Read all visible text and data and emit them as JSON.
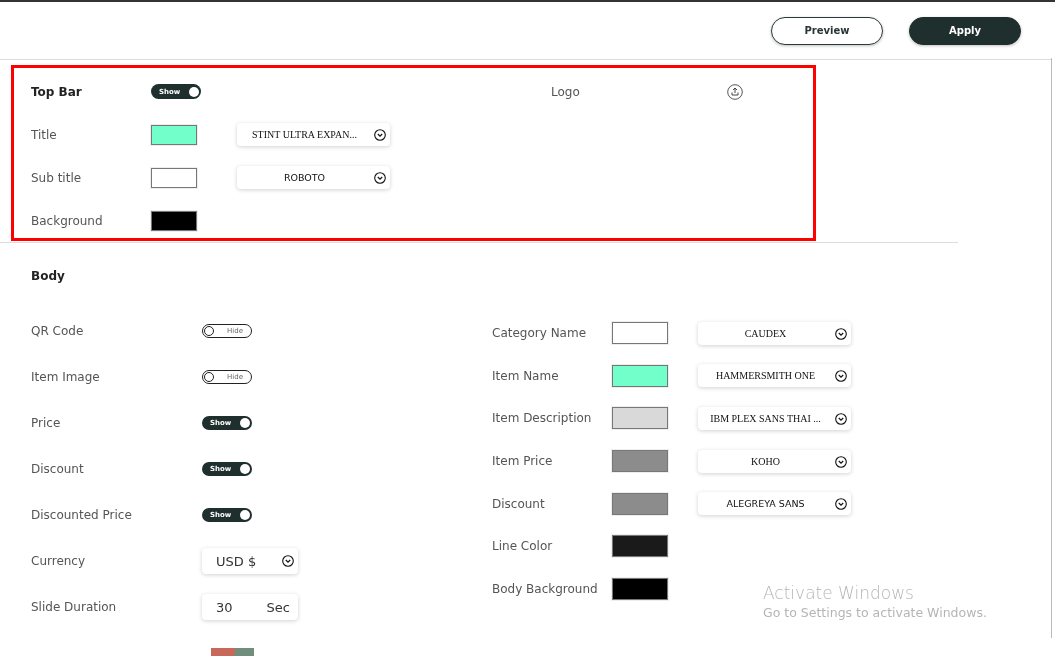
{
  "header": {
    "buttons": [
      {
        "label": "Preview",
        "kind": "outline"
      },
      {
        "label": "Apply",
        "kind": "filled"
      }
    ]
  },
  "top_bar": {
    "title": "Top Bar",
    "toggle": {
      "label": "Show",
      "on": true
    },
    "logo": {
      "label": "Logo"
    },
    "rows": [
      {
        "label": "Title",
        "color": "#72ffca",
        "font": {
          "text": "STINT ULTRA EXPAN...",
          "kind": "serif"
        }
      },
      {
        "label": "Sub title",
        "color": "#ffffff",
        "font": {
          "text": "ROBOTO",
          "kind": "sans"
        }
      },
      {
        "label": "Background",
        "color": "#000000"
      }
    ]
  },
  "body": {
    "title": "Body",
    "settings": [
      {
        "kind": "toggle",
        "label": "QR Code",
        "toggle": {
          "label": "Hide",
          "on": false
        }
      },
      {
        "kind": "toggle",
        "label": "Item Image",
        "toggle": {
          "label": "Hide",
          "on": false
        }
      },
      {
        "kind": "toggle",
        "label": "Price",
        "toggle": {
          "label": "Show",
          "on": true
        }
      },
      {
        "kind": "toggle",
        "label": "Discount",
        "toggle": {
          "label": "Show",
          "on": true
        }
      },
      {
        "kind": "toggle",
        "label": "Discounted Price",
        "toggle": {
          "label": "Show",
          "on": true
        }
      },
      {
        "kind": "select",
        "label": "Currency",
        "value": "USD $"
      },
      {
        "kind": "duration",
        "label": "Slide Duration",
        "value": "30",
        "unit": "Sec"
      }
    ],
    "styles": [
      {
        "label": "Category Name",
        "color": "#ffffff",
        "font": {
          "text": "CAUDEX",
          "kind": "serif"
        }
      },
      {
        "label": "Item Name",
        "color": "#72ffca",
        "font": {
          "text": "HAMMERSMITH ONE",
          "kind": "serif"
        }
      },
      {
        "label": "Item Description",
        "color": "#d9d9d9",
        "font": {
          "text": "IBM PLEX SANS THAI ...",
          "kind": "serif"
        }
      },
      {
        "label": "Item Price",
        "color": "#8c8c8c",
        "font": {
          "text": "KOHO",
          "kind": "serif"
        }
      },
      {
        "label": "Discount",
        "color": "#8c8c8c",
        "font": {
          "text": "ALEGREYA SANS",
          "kind": "sans"
        }
      },
      {
        "label": "Line Color",
        "color": "#1a1a1a"
      },
      {
        "label": "Body Background",
        "color": "#000000"
      }
    ]
  },
  "notice": {
    "title": "Activate Windows",
    "text": "Go to Settings to activate Windows."
  }
}
